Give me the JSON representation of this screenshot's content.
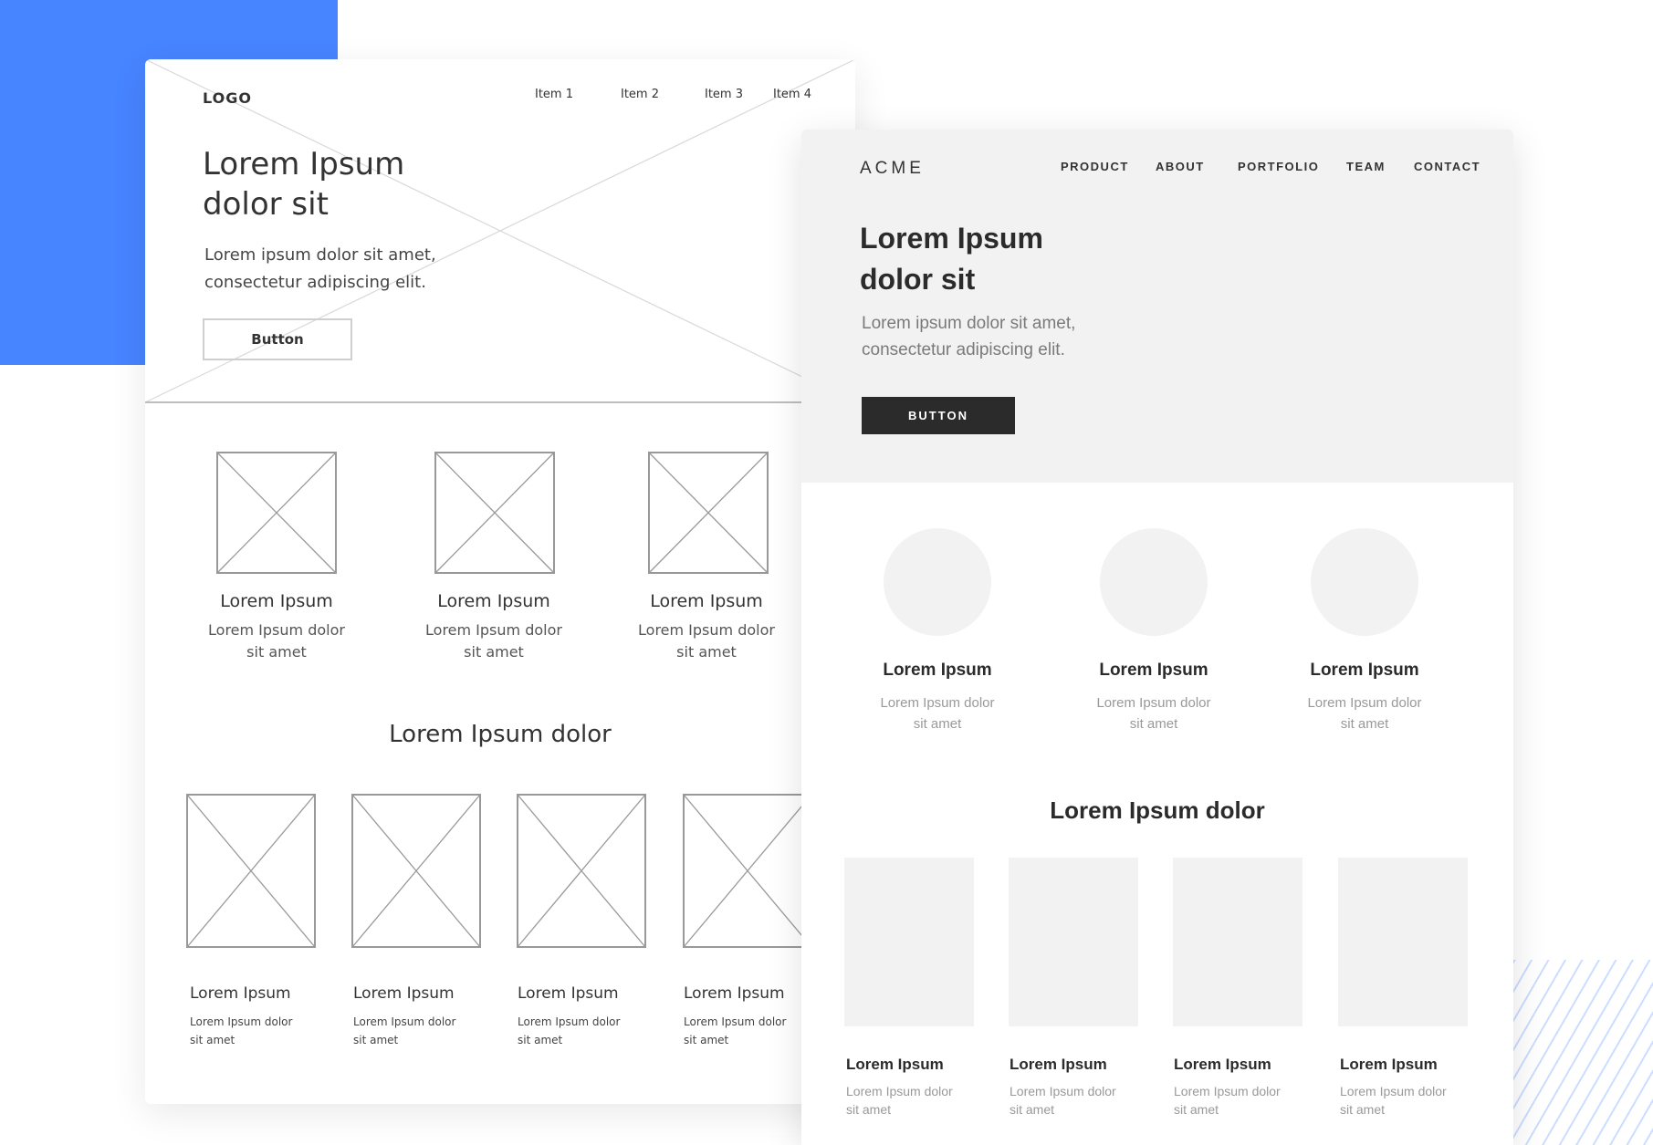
{
  "sketch": {
    "logo": "LOGO",
    "nav": [
      "Item 1",
      "Item 2",
      "Item 3",
      "Item 4"
    ],
    "hero_title_line1": "Lorem Ipsum",
    "hero_title_line2": "dolor sit",
    "hero_lead_line1": "Lorem ipsum dolor sit amet,",
    "hero_lead_line2": "consectetur adipiscing elit.",
    "button_label": "Button",
    "columns": [
      {
        "title": "Lorem Ipsum",
        "desc_line1": "Lorem Ipsum dolor",
        "desc_line2": "sit amet"
      },
      {
        "title": "Lorem Ipsum",
        "desc_line1": "Lorem Ipsum dolor",
        "desc_line2": "sit amet"
      },
      {
        "title": "Lorem Ipsum",
        "desc_line1": "Lorem Ipsum dolor",
        "desc_line2": "sit amet"
      }
    ],
    "section_title": "Lorem Ipsum dolor",
    "cards": [
      {
        "title": "Lorem Ipsum",
        "desc_line1": "Lorem Ipsum dolor",
        "desc_line2": "sit amet"
      },
      {
        "title": "Lorem Ipsum",
        "desc_line1": "Lorem Ipsum dolor",
        "desc_line2": "sit amet"
      },
      {
        "title": "Lorem Ipsum",
        "desc_line1": "Lorem Ipsum dolor",
        "desc_line2": "sit amet"
      },
      {
        "title": "Lorem Ipsum",
        "desc_line1": "Lorem Ipsum dolor",
        "desc_line2": "sit amet"
      }
    ]
  },
  "clean": {
    "logo": "ACME",
    "nav": [
      "PRODUCT",
      "ABOUT",
      "PORTFOLIO",
      "TEAM",
      "CONTACT"
    ],
    "hero_title_line1": "Lorem Ipsum",
    "hero_title_line2": "dolor sit",
    "hero_lead_line1": "Lorem ipsum dolor sit amet,",
    "hero_lead_line2": "consectetur adipiscing elit.",
    "button_label": "BUTTON",
    "columns": [
      {
        "title": "Lorem Ipsum",
        "desc_line1": "Lorem Ipsum dolor",
        "desc_line2": "sit amet"
      },
      {
        "title": "Lorem Ipsum",
        "desc_line1": "Lorem Ipsum dolor",
        "desc_line2": "sit amet"
      },
      {
        "title": "Lorem Ipsum",
        "desc_line1": "Lorem Ipsum dolor",
        "desc_line2": "sit amet"
      }
    ],
    "section_title": "Lorem Ipsum dolor",
    "cards": [
      {
        "title": "Lorem Ipsum",
        "desc_line1": "Lorem Ipsum dolor",
        "desc_line2": "sit amet"
      },
      {
        "title": "Lorem Ipsum",
        "desc_line1": "Lorem Ipsum dolor",
        "desc_line2": "sit amet"
      },
      {
        "title": "Lorem Ipsum",
        "desc_line1": "Lorem Ipsum dolor",
        "desc_line2": "sit amet"
      },
      {
        "title": "Lorem Ipsum",
        "desc_line1": "Lorem Ipsum dolor",
        "desc_line2": "sit amet"
      }
    ]
  },
  "colors": {
    "accent_blue": "#4784ff",
    "placeholder_gray": "#f2f2f2",
    "button_dark": "#2b2b2b"
  }
}
